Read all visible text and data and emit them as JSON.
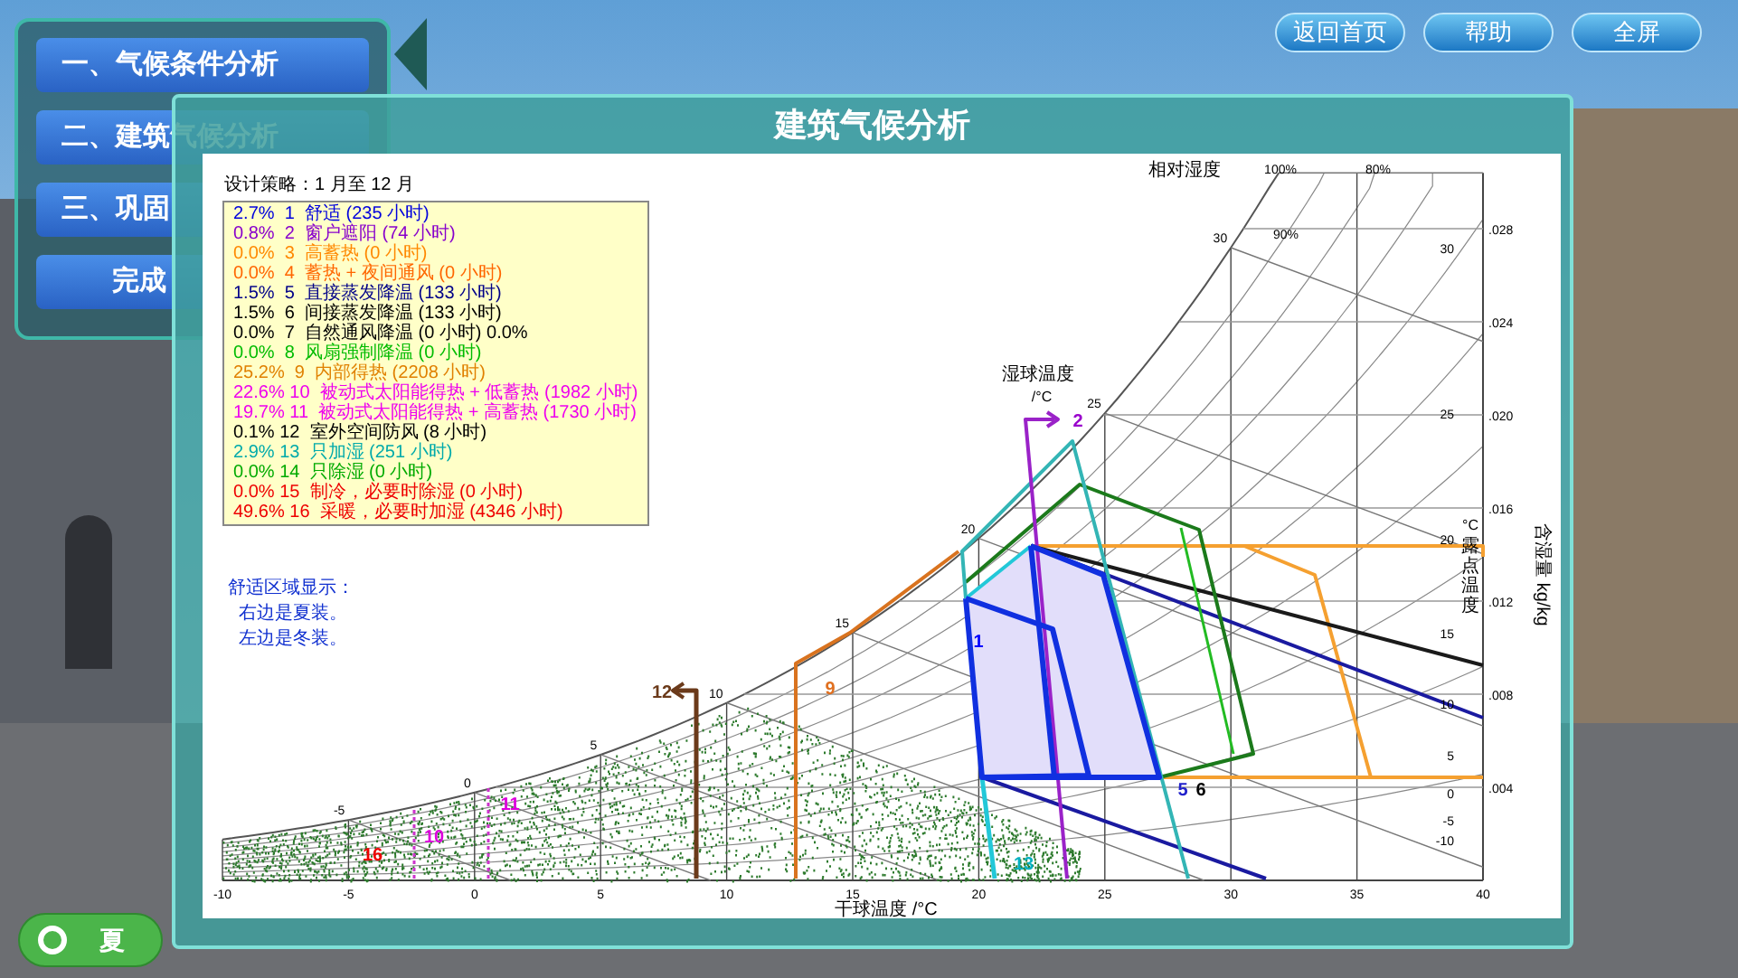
{
  "top_buttons": [
    "返回首页",
    "帮助",
    "全屏"
  ],
  "menu": {
    "items": [
      {
        "label": "一、气候条件分析"
      },
      {
        "label": "二、建筑气候分析"
      },
      {
        "label": "三、巩固"
      },
      {
        "label": "完成"
      }
    ]
  },
  "season_toggle": {
    "label": "夏"
  },
  "dialog": {
    "title": "建筑气候分析",
    "chart": {
      "legend_title": "设计策略：1 月至 12 月",
      "strategies": [
        {
          "text": "2.7%  1  舒适 (235 小时)",
          "color": "#0000dd"
        },
        {
          "text": "0.8%  2  窗户遮阳 (74 小时)",
          "color": "#8800cc"
        },
        {
          "text": "0.0%  3  高蓄热 (0 小时)",
          "color": "#ff8800"
        },
        {
          "text": "0.0%  4  蓄热 + 夜间通风 (0 小时)",
          "color": "#ff6600"
        },
        {
          "text": "1.5%  5  直接蒸发降温 (133 小时)",
          "color": "#000088"
        },
        {
          "text": "1.5%  6  间接蒸发降温 (133 小时)",
          "color": "#000000"
        },
        {
          "text": "0.0%  7  自然通风降温 (0 小时) 0.0%",
          "color": "#000000"
        },
        {
          "text": "0.0%  8  风扇强制降温 (0 小时)",
          "color": "#00bb00"
        },
        {
          "text": "25.2%  9  内部得热 (2208 小时)",
          "color": "#e08000"
        },
        {
          "text": "22.6% 10  被动式太阳能得热 + 低蓄热 (1982 小时)",
          "color": "#ee00ee"
        },
        {
          "text": "19.7% 11  被动式太阳能得热 + 高蓄热 (1730 小时)",
          "color": "#ee00ee"
        },
        {
          "text": "0.1% 12  室外空间防风 (8 小时)",
          "color": "#000000"
        },
        {
          "text": "2.9% 13  只加湿 (251 小时)",
          "color": "#00aaaa"
        },
        {
          "text": "0.0% 14  只除湿 (0 小时)",
          "color": "#00aa00"
        },
        {
          "text": "0.0% 15  制冷，必要时除湿 (0 小时)",
          "color": "#ee0000"
        },
        {
          "text": "49.6% 16  采暖，必要时加湿 (4346 小时)",
          "color": "#ee0000"
        }
      ],
      "comfort_note": [
        "舒适区域显示：",
        "右边是夏装。",
        "左边是冬装。"
      ],
      "rh_title": "相对湿度",
      "rh_labels": [
        "100%",
        "80%",
        "90%"
      ],
      "wet_bulb_title": "湿球温度",
      "wet_bulb_unit": "/°C",
      "wet_bulb_ticks": [
        "-5",
        "0",
        "5",
        "10",
        "15",
        "20",
        "25",
        "30"
      ],
      "x_title": "干球温度 /°C",
      "x_ticks": [
        "-10",
        "-5",
        "0",
        "5",
        "10",
        "15",
        "20",
        "25",
        "30",
        "35",
        "40"
      ],
      "humidity_ticks": [
        ".028",
        ".024",
        ".020",
        ".016",
        ".012",
        ".008",
        ".004"
      ],
      "humidity_title": "含湿量 kg/kg",
      "dewpoint_title": "露点温度",
      "dewpoint_unit": "°C",
      "dewpoint_ticks": [
        "30",
        "25",
        "20",
        "15",
        "10",
        "5",
        "0",
        "-5",
        "-10"
      ],
      "zone_labels": [
        {
          "text": "1",
          "color": "#0000ff"
        },
        {
          "text": "2",
          "color": "#9900cc"
        },
        {
          "text": "5",
          "color": "#2222cc"
        },
        {
          "text": "6",
          "color": "#000000"
        },
        {
          "text": "9",
          "color": "#e07020"
        },
        {
          "text": "10",
          "color": "#dd00dd"
        },
        {
          "text": "11",
          "color": "#dd00dd"
        },
        {
          "text": "12",
          "color": "#6b3a1a"
        },
        {
          "text": "13",
          "color": "#00b0c0"
        },
        {
          "text": "16",
          "color": "#ee0000"
        }
      ]
    }
  }
}
